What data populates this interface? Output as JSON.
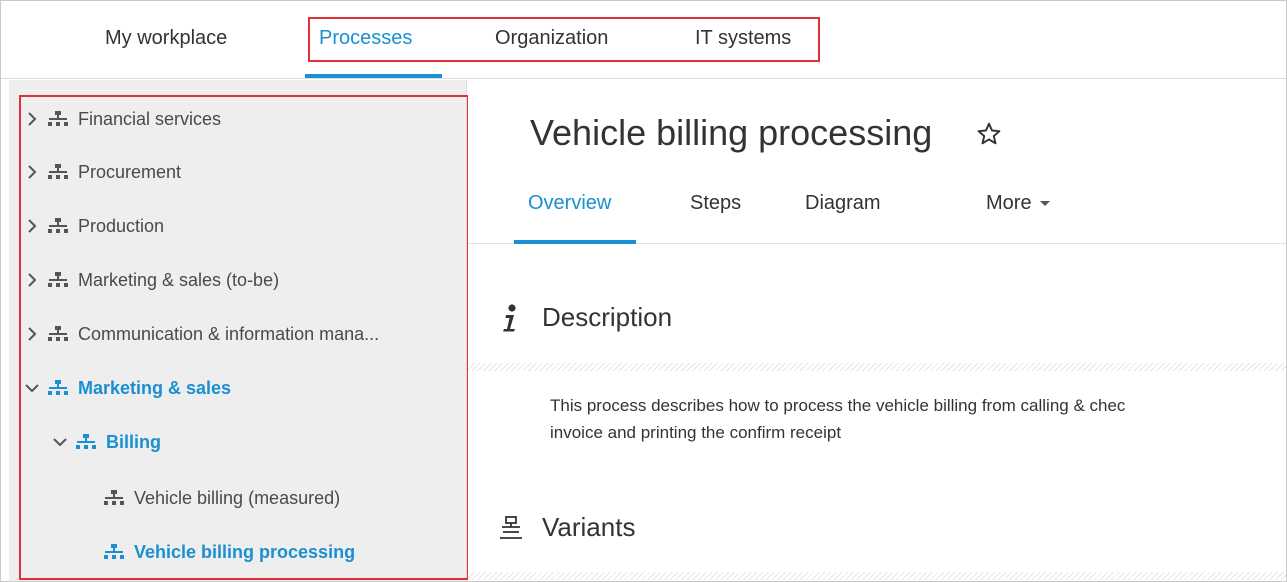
{
  "topnav": {
    "tabs": [
      {
        "label": "My workplace"
      },
      {
        "label": "Processes"
      },
      {
        "label": "Organization"
      },
      {
        "label": "IT systems"
      }
    ]
  },
  "sidebar": {
    "items": [
      {
        "label": "Financial services",
        "expanded": false
      },
      {
        "label": "Procurement",
        "expanded": false
      },
      {
        "label": "Production",
        "expanded": false
      },
      {
        "label": "Marketing & sales (to-be)",
        "expanded": false
      },
      {
        "label": "Communication & information mana...",
        "expanded": false
      },
      {
        "label": "Marketing & sales",
        "expanded": true
      },
      {
        "label": "Billing",
        "expanded": true
      },
      {
        "label": "Vehicle billing (measured)"
      },
      {
        "label": "Vehicle billing processing"
      }
    ]
  },
  "main": {
    "title": "Vehicle billing processing",
    "tabs": [
      {
        "label": "Overview"
      },
      {
        "label": "Steps"
      },
      {
        "label": "Diagram"
      },
      {
        "label": "More"
      }
    ],
    "description": {
      "heading": "Description",
      "line1": "This process describes how to process the vehicle billing from calling & chec",
      "line2": "invoice and printing the confirm receipt"
    },
    "variants": {
      "heading": "Variants"
    }
  },
  "colors": {
    "accent": "#1a8fd1",
    "highlight": "#e0303a",
    "sidebar_bg": "#eeeeee"
  },
  "icons": {
    "tree_node": "hierarchy-icon",
    "expand": "chevron-right-icon",
    "collapse": "chevron-down-icon",
    "favorite": "star-outline-icon",
    "info": "info-icon",
    "variants": "variants-icon"
  }
}
